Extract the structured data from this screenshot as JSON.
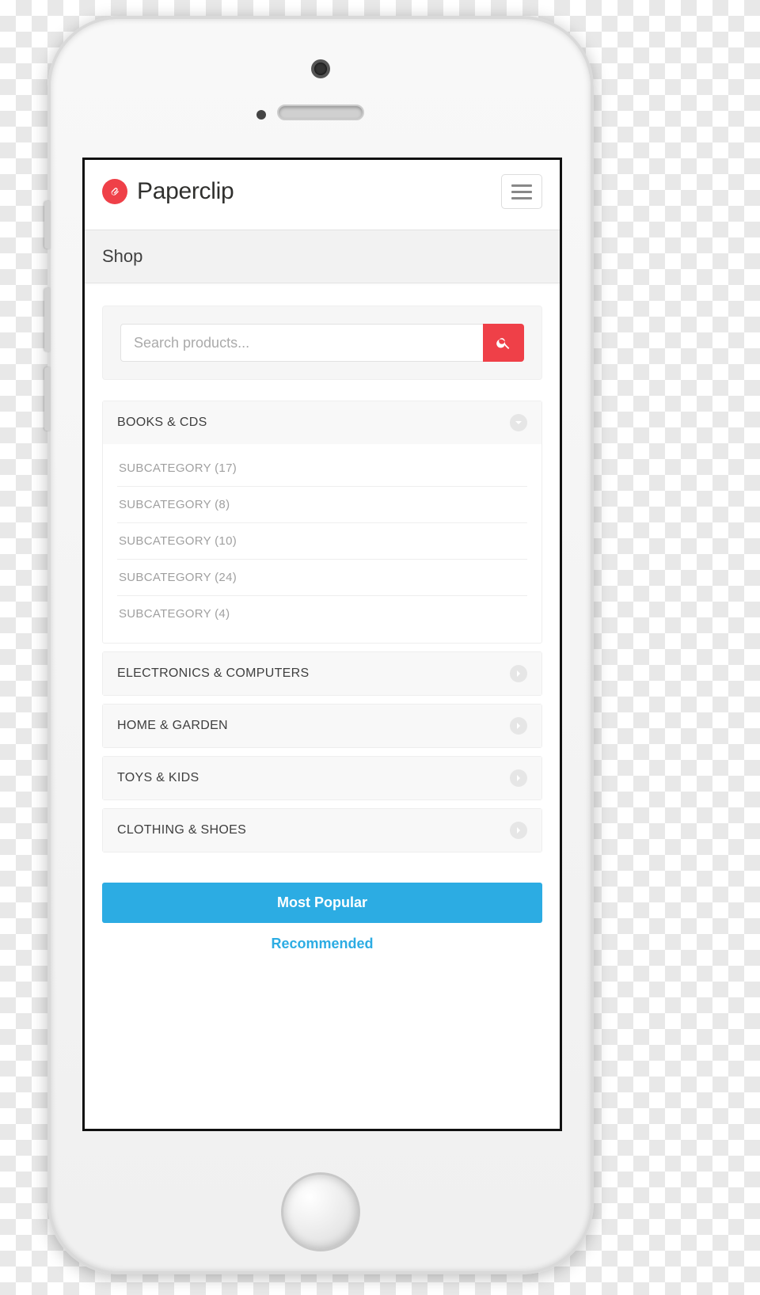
{
  "app": {
    "name": "Paperclip"
  },
  "page": {
    "title": "Shop"
  },
  "search": {
    "placeholder": "Search products..."
  },
  "categories": [
    {
      "label": "BOOKS & CDS",
      "expanded": true,
      "subcategories": [
        {
          "label": "SUBCATEGORY (17)"
        },
        {
          "label": "SUBCATEGORY (8)"
        },
        {
          "label": "SUBCATEGORY (10)"
        },
        {
          "label": "SUBCATEGORY (24)"
        },
        {
          "label": "SUBCATEGORY (4)"
        }
      ]
    },
    {
      "label": "ELECTRONICS & COMPUTERS",
      "expanded": false
    },
    {
      "label": "HOME & GARDEN",
      "expanded": false
    },
    {
      "label": "TOYS & KIDS",
      "expanded": false
    },
    {
      "label": "CLOTHING & SHOES",
      "expanded": false
    }
  ],
  "tabs": {
    "primary": "Most Popular",
    "secondary": "Recommended"
  },
  "colors": {
    "accent_red": "#ef4048",
    "accent_blue": "#2cace3"
  }
}
